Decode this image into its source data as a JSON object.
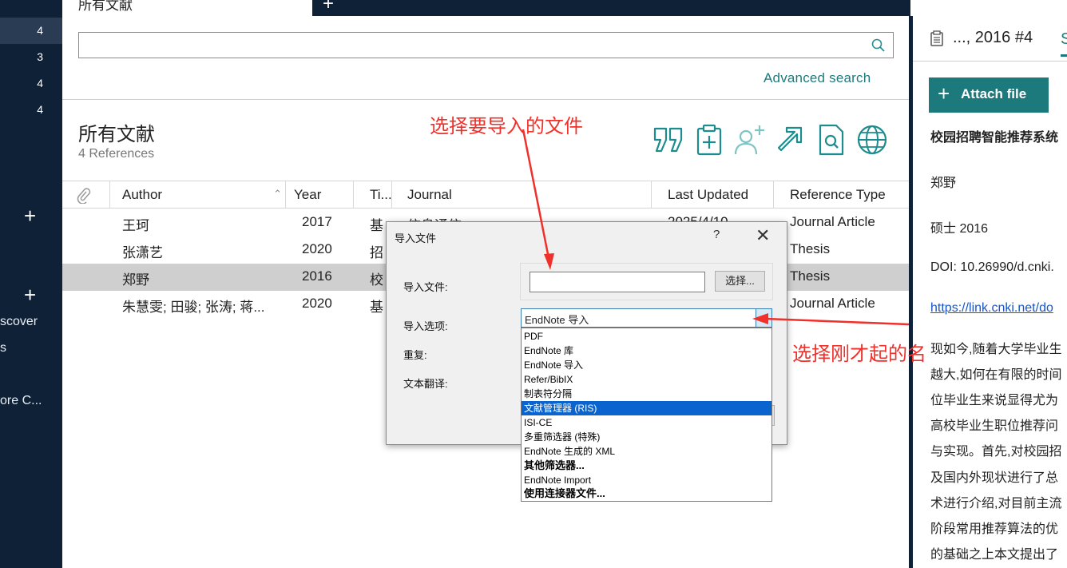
{
  "sidebar": {
    "counts": [
      "4",
      "3",
      "4",
      "4"
    ],
    "labels": [
      "scover",
      "s",
      "ore C..."
    ]
  },
  "tab": {
    "title": "所有文献"
  },
  "search": {
    "placeholder": "",
    "advanced_label": "Advanced search"
  },
  "library": {
    "title": "所有文献",
    "count_text": "4 References"
  },
  "toolbar": {
    "icons": [
      "quote-icon",
      "add-clipboard-icon",
      "add-user-icon",
      "share-arrow-icon",
      "find-document-icon",
      "globe-icon"
    ]
  },
  "table": {
    "headers": [
      "Author",
      "Year",
      "Ti...",
      "Journal",
      "Last Updated",
      "Reference Type"
    ],
    "rows": [
      {
        "author": "王珂",
        "year": "2017",
        "title": "基",
        "journal": "信息通信",
        "updated": "2025/4/10",
        "type": "Journal Article",
        "selected": false
      },
      {
        "author": "张潇艺",
        "year": "2020",
        "title": "招",
        "journal": "",
        "updated": "",
        "type": "Thesis",
        "selected": false
      },
      {
        "author": "郑野",
        "year": "2016",
        "title": "校",
        "journal": "",
        "updated": "",
        "type": "Thesis",
        "selected": true
      },
      {
        "author": "朱慧雯; 田骏; 张涛; 蒋...",
        "year": "2020",
        "title": "基",
        "journal": "",
        "updated": "",
        "type": "Journal Article",
        "selected": false
      }
    ]
  },
  "right_panel": {
    "header": "..., 2016 #4",
    "tab_letter": "S",
    "attach_label": "Attach file",
    "title": "校园招聘智能推荐系统",
    "author": "郑野",
    "degree_year": "硕士 2016",
    "doi": "DOI: 10.26990/d.cnki.",
    "link": "https://link.cnki.net/do",
    "abstract_lines": [
      "现如今,随着大学毕业生",
      "越大,如何在有限的时间",
      "位毕业生来说显得尤为",
      "高校毕业生职位推荐问",
      "与实现。首先,对校园招",
      "及国内外现状进行了总",
      "术进行介绍,对目前主流",
      "阶段常用推荐算法的优",
      "的基础之上本文提出了"
    ]
  },
  "dialog": {
    "title": "导入文件",
    "help": "?",
    "close": "✕",
    "file_label": "导入文件:",
    "file_value": "",
    "choose_button": "选择...",
    "option_label": "导入选项:",
    "duplicate_label": "重复:",
    "translate_label": "文本翻译:",
    "selected_option": "EndNote 导入",
    "options": [
      "PDF",
      "EndNote 库",
      "EndNote 导入",
      "Refer/BibIX",
      "制表符分隔",
      "文献管理器 (RIS)",
      "ISI-CE",
      "多重筛选器 (特殊)",
      "EndNote 生成的 XML",
      "其他筛选器...",
      "EndNote Import",
      "使用连接器文件..."
    ],
    "highlighted_index": 5,
    "bold_indexes": [
      9,
      11
    ]
  },
  "annotations": {
    "choose_file": "选择要导入的文件",
    "choose_name": "选择刚才起的名"
  },
  "colors": {
    "sidebar_bg": "#0f2136",
    "accent": "#1d7a7c",
    "selected_row": "#cfcfcf",
    "annotation": "#f0302a",
    "dropdown_highlight": "#0a64d0"
  }
}
